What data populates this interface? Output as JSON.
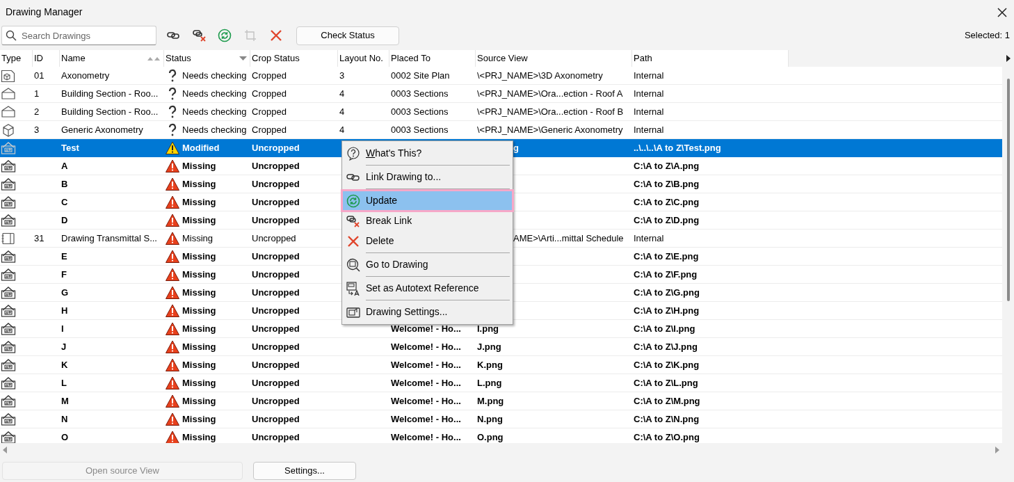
{
  "window": {
    "title": "Drawing Manager"
  },
  "toolbar": {
    "search": {
      "placeholder": "Search Drawings"
    },
    "tools": [
      {
        "kind": "link",
        "disabled": false
      },
      {
        "kind": "break",
        "disabled": false
      },
      {
        "kind": "update",
        "disabled": false
      },
      {
        "kind": "crop",
        "disabled": true
      },
      {
        "kind": "delete",
        "disabled": false
      }
    ],
    "check_button": "Check Status",
    "selected_count": "Selected: 1"
  },
  "table": {
    "columns": [
      {
        "label": "Type",
        "kind": "plain"
      },
      {
        "label": "ID",
        "kind": "plain"
      },
      {
        "label": "Name",
        "kind": "sorted"
      },
      {
        "label": "Status",
        "kind": "dropdown"
      },
      {
        "label": "Crop Status",
        "kind": "plain"
      },
      {
        "label": "Layout No.",
        "kind": "plain"
      },
      {
        "label": "Placed To",
        "kind": "plain"
      },
      {
        "label": "Source View",
        "kind": "plain"
      },
      {
        "label": "Path",
        "kind": "plain"
      }
    ],
    "rows": [
      {
        "kind": "axonometry",
        "id": "01",
        "name": "Axonometry",
        "status": {
          "kind": "question",
          "text": "Needs checking"
        },
        "crop": "Cropped",
        "layout": "3",
        "placed_to": "0002 Site Plan",
        "source_view": {
          "kind": "full",
          "text": "\\<PRJ_NAME>\\3D Axonometry"
        },
        "path": "Internal",
        "selected": false
      },
      {
        "kind": "section",
        "id": "1",
        "name": "Building Section - Roo...",
        "status": {
          "kind": "question",
          "text": "Needs checking"
        },
        "crop": "Cropped",
        "layout": "4",
        "placed_to": "0003 Sections",
        "source_view": {
          "kind": "full",
          "text": "\\<PRJ_NAME>\\Ora...ection - Roof A"
        },
        "path": "Internal",
        "selected": false
      },
      {
        "kind": "section",
        "id": "2",
        "name": "Building Section - Roo...",
        "status": {
          "kind": "question",
          "text": "Needs checking"
        },
        "crop": "Cropped",
        "layout": "4",
        "placed_to": "0003 Sections",
        "source_view": {
          "kind": "full",
          "text": "\\<PRJ_NAME>\\Ora...ection - Roof B"
        },
        "path": "Internal",
        "selected": false
      },
      {
        "kind": "box",
        "id": "3",
        "name": "Generic Axonometry",
        "status": {
          "kind": "question",
          "text": "Needs checking"
        },
        "crop": "Cropped",
        "layout": "4",
        "placed_to": "0003 Sections",
        "source_view": {
          "kind": "full",
          "text": "\\<PRJ_NAME>\\Generic Axonometry"
        },
        "path": "Internal",
        "selected": false
      },
      {
        "kind": "image",
        "name": "Test",
        "status": {
          "kind": "warning",
          "text": "Modified"
        },
        "crop": "Uncropped",
        "source_view": {
          "kind": "partial",
          "text": "g"
        },
        "path": "..\\..\\..\\A to Z\\Test.png",
        "selected": true
      },
      {
        "kind": "image",
        "name": "A",
        "status": {
          "kind": "error",
          "text": "Missing"
        },
        "crop": "Uncropped",
        "path": "C:\\A to Z\\A.png",
        "selected": false
      },
      {
        "kind": "image",
        "name": "B",
        "status": {
          "kind": "error",
          "text": "Missing"
        },
        "crop": "Uncropped",
        "path": "C:\\A to Z\\B.png",
        "selected": false
      },
      {
        "kind": "image",
        "name": "C",
        "status": {
          "kind": "error",
          "text": "Missing"
        },
        "crop": "Uncropped",
        "path": "C:\\A to Z\\C.png",
        "selected": false
      },
      {
        "kind": "image",
        "name": "D",
        "status": {
          "kind": "error",
          "text": "Missing"
        },
        "crop": "Uncropped",
        "path": "C:\\A to Z\\D.png",
        "selected": false
      },
      {
        "kind": "schedule",
        "id": "31",
        "name": "Drawing Transmittal S...",
        "status": {
          "kind": "error",
          "text": "Missing"
        },
        "crop": "Uncropped",
        "source_view": {
          "kind": "partial",
          "text": "AME>\\Arti...mittal Schedule"
        },
        "path": "Internal",
        "selected": false
      },
      {
        "kind": "image",
        "name": "E",
        "status": {
          "kind": "error",
          "text": "Missing"
        },
        "crop": "Uncropped",
        "path": "C:\\A to Z\\E.png",
        "selected": false
      },
      {
        "kind": "image",
        "name": "F",
        "status": {
          "kind": "error",
          "text": "Missing"
        },
        "crop": "Uncropped",
        "path": "C:\\A to Z\\F.png",
        "selected": false
      },
      {
        "kind": "image",
        "name": "G",
        "status": {
          "kind": "error",
          "text": "Missing"
        },
        "crop": "Uncropped",
        "path": "C:\\A to Z\\G.png",
        "selected": false
      },
      {
        "kind": "image",
        "name": "H",
        "status": {
          "kind": "error",
          "text": "Missing"
        },
        "crop": "Uncropped",
        "path": "C:\\A to Z\\H.png",
        "selected": false
      },
      {
        "kind": "image",
        "name": "I",
        "status": {
          "kind": "error",
          "text": "Missing"
        },
        "crop": "Uncropped",
        "placed_to": "Welcome! - Ho...",
        "source_view": {
          "kind": "full",
          "text": "I.png"
        },
        "path": "C:\\A to Z\\I.png",
        "selected": false
      },
      {
        "kind": "image",
        "name": "J",
        "status": {
          "kind": "error",
          "text": "Missing"
        },
        "crop": "Uncropped",
        "placed_to": "Welcome! - Ho...",
        "source_view": {
          "kind": "full",
          "text": "J.png"
        },
        "path": "C:\\A to Z\\J.png",
        "selected": false
      },
      {
        "kind": "image",
        "name": "K",
        "status": {
          "kind": "error",
          "text": "Missing"
        },
        "crop": "Uncropped",
        "placed_to": "Welcome! - Ho...",
        "source_view": {
          "kind": "full",
          "text": "K.png"
        },
        "path": "C:\\A to Z\\K.png",
        "selected": false
      },
      {
        "kind": "image",
        "name": "L",
        "status": {
          "kind": "error",
          "text": "Missing"
        },
        "crop": "Uncropped",
        "placed_to": "Welcome! - Ho...",
        "source_view": {
          "kind": "full",
          "text": "L.png"
        },
        "path": "C:\\A to Z\\L.png",
        "selected": false
      },
      {
        "kind": "image",
        "name": "M",
        "status": {
          "kind": "error",
          "text": "Missing"
        },
        "crop": "Uncropped",
        "placed_to": "Welcome! - Ho...",
        "source_view": {
          "kind": "full",
          "text": "M.png"
        },
        "path": "C:\\A to Z\\M.png",
        "selected": false
      },
      {
        "kind": "image",
        "name": "N",
        "status": {
          "kind": "error",
          "text": "Missing"
        },
        "crop": "Uncropped",
        "placed_to": "Welcome! - Ho...",
        "source_view": {
          "kind": "full",
          "text": "N.png"
        },
        "path": "C:\\A to Z\\N.png",
        "selected": false
      },
      {
        "kind": "image",
        "name": "O",
        "status": {
          "kind": "error",
          "text": "Missing"
        },
        "crop": "Uncropped",
        "placed_to": "Welcome! - Ho...",
        "source_view": {
          "kind": "full",
          "text": "O.png"
        },
        "path": "C:\\A to Z\\O.png",
        "selected": false
      }
    ]
  },
  "context_menu": {
    "items": [
      {
        "kind": "help",
        "label": "What's This?",
        "underline_first": true,
        "selected": false,
        "separator_after": true
      },
      {
        "kind": "link",
        "label": "Link Drawing to...",
        "underline_first": false,
        "selected": false,
        "separator_after": true
      },
      {
        "kind": "update",
        "label": "Update",
        "underline_first": false,
        "selected": true,
        "separator_after": false
      },
      {
        "kind": "break",
        "label": "Break Link",
        "underline_first": false,
        "selected": false,
        "separator_after": false
      },
      {
        "kind": "delete",
        "label": "Delete",
        "underline_first": false,
        "selected": false,
        "separator_after": true
      },
      {
        "kind": "goto",
        "label": "Go to Drawing",
        "underline_first": false,
        "selected": false,
        "separator_after": true
      },
      {
        "kind": "autotext",
        "label": "Set as Autotext Reference",
        "underline_first": false,
        "selected": false,
        "separator_after": true
      },
      {
        "kind": "settings",
        "label": "Drawing Settings...",
        "underline_first": false,
        "selected": false,
        "separator_after": false
      }
    ]
  },
  "footer": {
    "buttons": [
      {
        "label": "Open source View",
        "disabled": true
      },
      {
        "label": "Settings...",
        "disabled": false
      }
    ]
  }
}
